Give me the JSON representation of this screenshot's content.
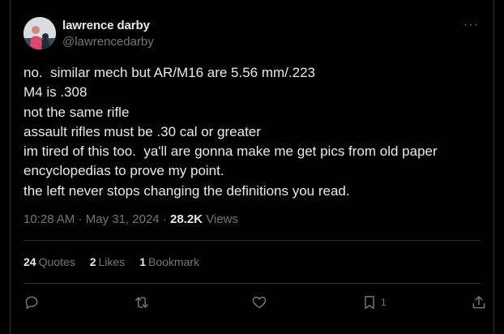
{
  "author": {
    "display_name": "lawrence darby",
    "handle": "@lawrencedarby"
  },
  "more_label": "···",
  "post": {
    "lines": [
      "no.  similar mech but AR/M16 are 5.56 mm/.223",
      "M4 is .308",
      "not the same rifle",
      "assault rifles must be .30 cal or greater",
      "im tired of this too.  ya'll are gonna make me get pics from old paper",
      "encyclopedias to prove my point.",
      "the left never stops changing the definitions you read."
    ]
  },
  "meta": {
    "time": "10:28 AM",
    "separator": " · ",
    "date": "May 31, 2024",
    "views_count": "28.2K",
    "views_label": "Views"
  },
  "stats": {
    "quotes_count": "24",
    "quotes_label": "Quotes",
    "likes_count": "2",
    "likes_label": "Likes",
    "bookmarks_count": "1",
    "bookmarks_label": "Bookmark"
  },
  "actions": {
    "bookmark_count": "1"
  },
  "colors": {
    "background": "#000000",
    "text": "#e7e9ea",
    "muted": "#71767b",
    "border": "#2f3336"
  }
}
